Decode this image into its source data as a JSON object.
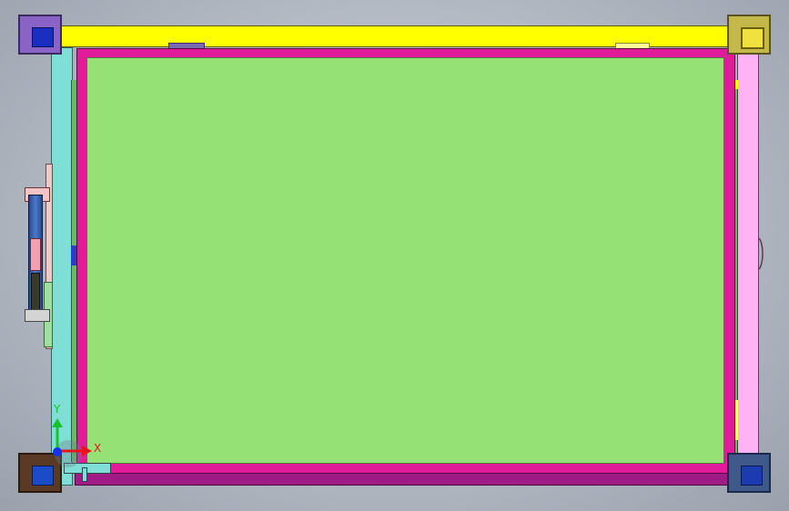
{
  "viewport": {
    "title": "",
    "background_color": "#b8bec7"
  },
  "triad": {
    "x_label": "X",
    "y_label": "Y",
    "x_color": "#e8141c",
    "y_color": "#19c12c",
    "z_color": "#1432e8"
  },
  "parts": {
    "main_panel_color": "#95e176",
    "border_color": "#e01c9a",
    "top_rail_color": "#ffff00",
    "left_rail_color": "#7fdfd6",
    "right_rail_color": "#ffb3f5",
    "bottom_rail_color": "#a01b86",
    "corner_top_left_color": "#8a63c6",
    "corner_top_right_color": "#c4b84a",
    "corner_bottom_left_color": "#5a3a24",
    "corner_bottom_right_color": "#3f5a8a",
    "corner_block_color": "#1a2ec0"
  }
}
